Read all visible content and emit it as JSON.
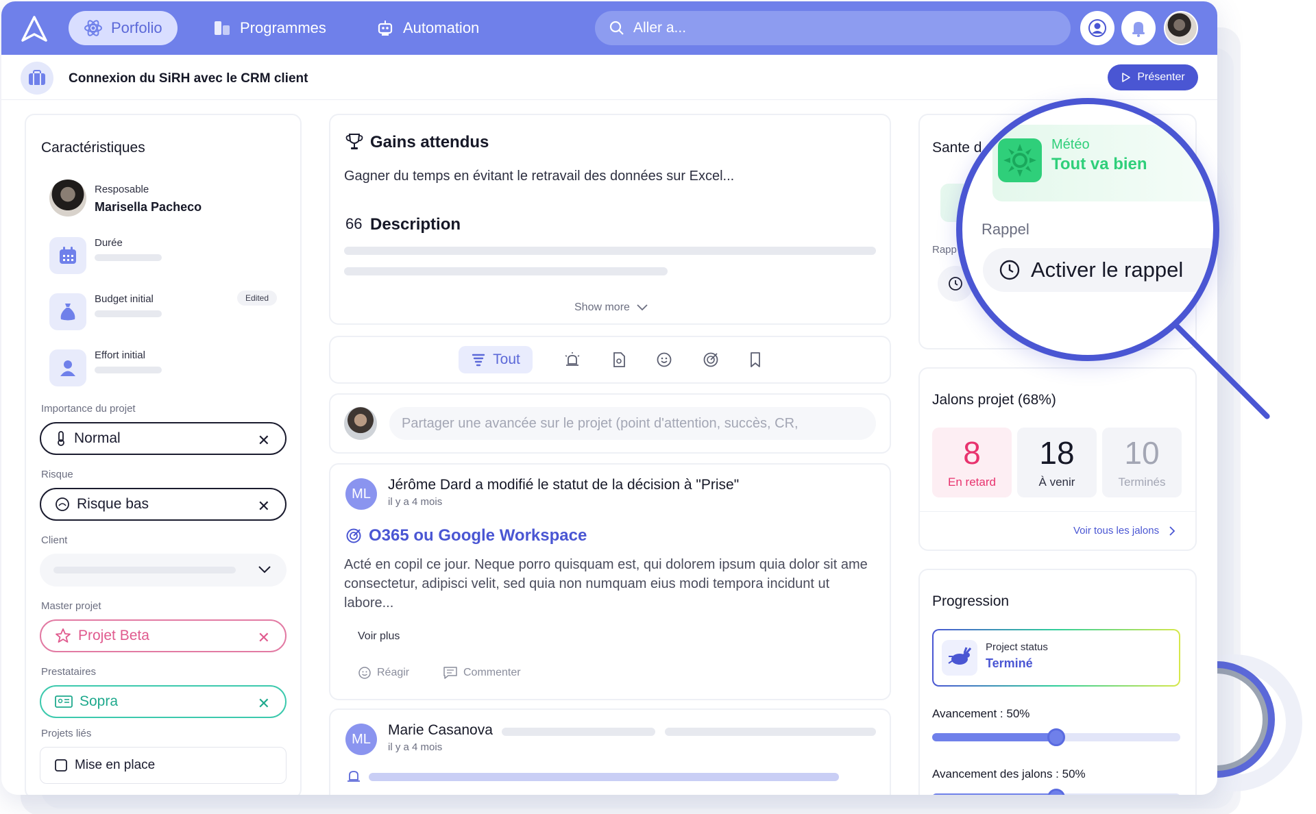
{
  "nav": {
    "portfolio": "Porfolio",
    "programmes": "Programmes",
    "automation": "Automation",
    "search_placeholder": "Aller a..."
  },
  "project": {
    "title": "Connexion du SiRH avec le CRM client",
    "present_label": "Présenter"
  },
  "characteristics": {
    "title": "Caractéristiques",
    "responsible_label": "Resposable",
    "responsible_name": "Marisella Pacheco",
    "duration_label": "Durée",
    "budget_label": "Budget initial",
    "budget_badge": "Edited",
    "effort_label": "Effort initial",
    "importance_label": "Importance du projet",
    "importance_value": "Normal",
    "risk_label": "Risque",
    "risk_value": "Risque bas",
    "client_label": "Client",
    "master_label": "Master projet",
    "master_value": "Projet Beta",
    "providers_label": "Prestataires",
    "providers_value": "Sopra",
    "linked_label": "Projets liés",
    "linked_value": "Mise en place"
  },
  "gains": {
    "title": "Gains attendus",
    "text": "Gagner du temps en évitant le retravail des données sur Excel...",
    "quote_mark": "66",
    "description_title": "Description",
    "show_more": "Show more"
  },
  "tabs": {
    "all": "Tout"
  },
  "composer": {
    "placeholder": "Partager une avancée sur le projet (point d'attention, succès, CR,"
  },
  "post1": {
    "initials": "ML",
    "headline": "Jérôme Dard a modifié le statut de la décision à \"Prise\"",
    "time": "il y a 4 mois",
    "decision_title": "O365 ou Google Workspace",
    "body": "Acté en copil ce jour. Neque porro quisquam est, qui dolorem ipsum quia dolor sit ame consectetur, adipisci velit, sed quia non numquam eius modi tempora incidunt ut labore...",
    "see_more": "Voir plus",
    "react": "Réagir",
    "comment": "Commenter"
  },
  "post2": {
    "initials": "ML",
    "author": "Marie Casanova",
    "time": "il y a 4 mois"
  },
  "health": {
    "title_partial": "Sante d",
    "reminder_partial": "Rapp"
  },
  "magnifier": {
    "weather_label": "Météo",
    "weather_value": "Tout va bien",
    "reminder_label": "Rappel",
    "reminder_action": "Activer le rappel"
  },
  "milestones": {
    "title": "Jalons projet (68%)",
    "late_count": "8",
    "late_label": "En retard",
    "upcoming_count": "18",
    "upcoming_label": "À venir",
    "done_count": "10",
    "done_label": "Terminés",
    "see_all": "Voir tous les jalons"
  },
  "progress": {
    "title": "Progression",
    "status_label": "Project status",
    "status_value": "Terminé",
    "advancement_label": "Avancement : 50%",
    "advancement_value": 0.5,
    "milestones_label": "Avancement des jalons : 50%",
    "milestones_value": 0.5
  },
  "colors": {
    "brand": "#6f80ea",
    "accent": "#4a56d3",
    "late": "#e8336e",
    "success": "#2fcf7a"
  }
}
